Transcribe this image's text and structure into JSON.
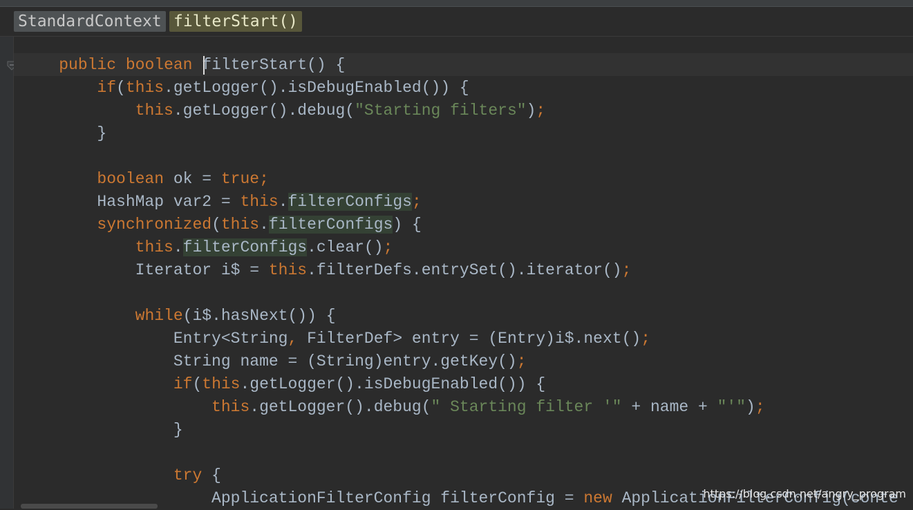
{
  "breadcrumb": {
    "class_name": "StandardContext",
    "method_name": "filterStart()"
  },
  "fold_icon": "fold-marker-icon",
  "colors": {
    "background": "#2b2b2b",
    "keyword": "#cc7832",
    "string": "#6a8759",
    "identifier": "#a9b7c6",
    "usage_highlight": "#344134",
    "breadcrumb_method": "#58573a"
  },
  "code": {
    "l1a": "public",
    "l1b": "boolean",
    "l1c": "filterStart() {",
    "l2a": "if",
    "l2b": "(",
    "l2c": "this",
    "l2d": ".getLogger().isDebugEnabled()) {",
    "l3a": "this",
    "l3b": ".getLogger().debug(",
    "l3c": "\"Starting filters\"",
    "l3d": ")",
    "l3e": ";",
    "l4": "}",
    "l6a": "boolean",
    "l6b": "ok = ",
    "l6c": "true",
    "l6d": ";",
    "l7a": "HashMap var2 = ",
    "l7b": "this",
    "l7c": ".",
    "l7d": "filterConfigs",
    "l7e": ";",
    "l8a": "synchronized",
    "l8b": "(",
    "l8c": "this",
    "l8d": ".",
    "l8e": "filterConfigs",
    "l8f": ") {",
    "l9a": "this",
    "l9b": ".",
    "l9c": "filterConfigs",
    "l9d": ".clear()",
    "l9e": ";",
    "l10a": "Iterator i$ = ",
    "l10b": "this",
    "l10c": ".filterDefs.entrySet().iterator()",
    "l10d": ";",
    "l12a": "while",
    "l12b": "(i$.hasNext()) {",
    "l13a": "Entry<String",
    "l13b": ",",
    "l13c": " FilterDef> entry = (Entry)i$.next()",
    "l13d": ";",
    "l14a": "String name = (String)entry.getKey()",
    "l14b": ";",
    "l15a": "if",
    "l15b": "(",
    "l15c": "this",
    "l15d": ".getLogger().isDebugEnabled()) {",
    "l16a": "this",
    "l16b": ".getLogger().debug(",
    "l16c": "\" Starting filter '\"",
    "l16d": " + name + ",
    "l16e": "\"'\"",
    "l16f": ")",
    "l16g": ";",
    "l17": "}",
    "l19a": "try",
    "l19b": " {",
    "l20a": "ApplicationFilterConfig filterConfig = ",
    "l20b": "new",
    "l20c": " ApplicationFilterConfig(",
    "l20d": "conte"
  },
  "watermark": "https://blog.csdn.net/angry_program"
}
